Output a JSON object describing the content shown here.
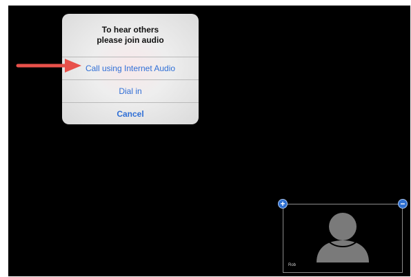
{
  "dialog": {
    "title_line1": "To hear others",
    "title_line2": "please join audio",
    "options": [
      {
        "label": "Call using Internet Audio"
      },
      {
        "label": "Dial in"
      },
      {
        "label": "Cancel"
      }
    ]
  },
  "video_tile": {
    "name": "Rob",
    "zoom_in_icon": "+",
    "zoom_out_icon": "−"
  },
  "colors": {
    "link_blue": "#2f6fd6",
    "arrow_red": "#e8504a",
    "button_blue": "#2e6fd0",
    "background": "#000000"
  },
  "icons": {
    "pointer": "arrow-right-icon",
    "avatar": "person-silhouette-icon",
    "zoom_in": "plus-circle-icon",
    "zoom_out": "minus-circle-icon"
  }
}
